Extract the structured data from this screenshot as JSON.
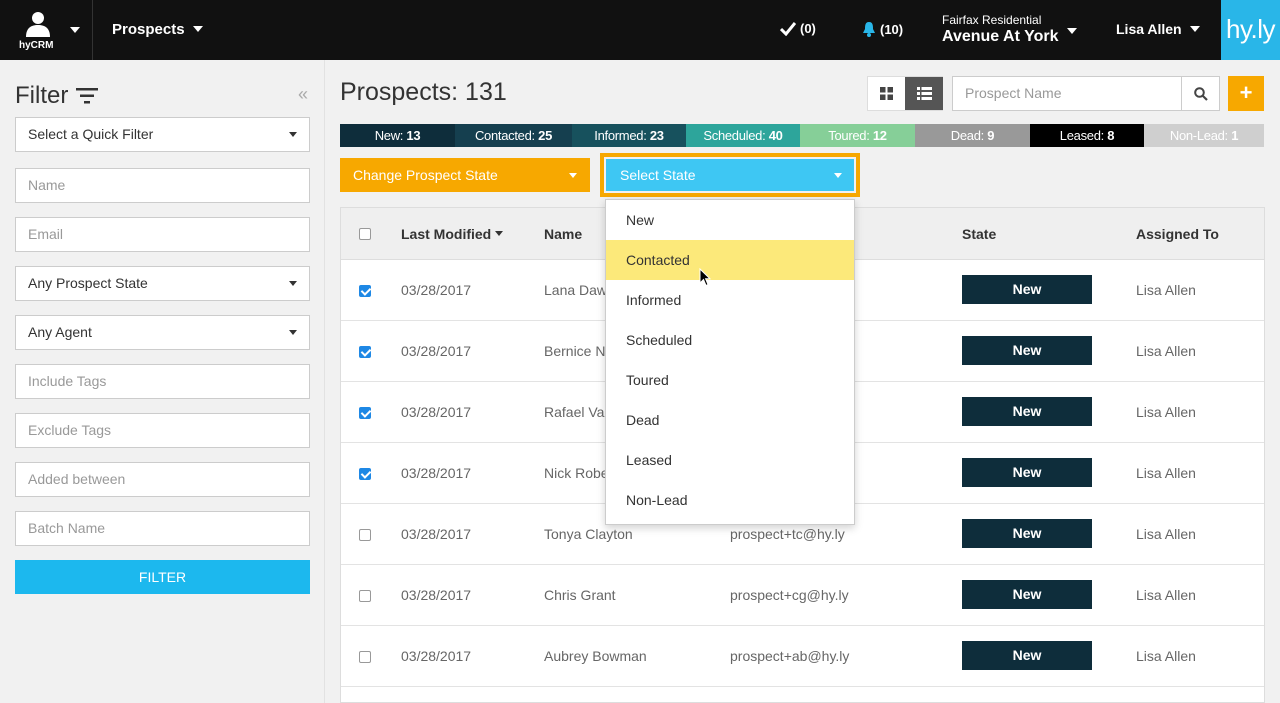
{
  "topbar": {
    "brand": "hyCRM",
    "module": "Prospects",
    "tasks": "(0)",
    "notifications": "(10)",
    "company": "Fairfax Residential",
    "property": "Avenue At York",
    "user": "Lisa Allen",
    "logo": "hy.ly"
  },
  "sidebar": {
    "title": "Filter",
    "quick_filter": "Select a Quick Filter",
    "name_placeholder": "Name",
    "email_placeholder": "Email",
    "prospect_state": "Any Prospect State",
    "agent": "Any Agent",
    "include_tags": "Include Tags",
    "exclude_tags": "Exclude Tags",
    "added_between": "Added between",
    "batch_name": "Batch Name",
    "filter_button": "FILTER"
  },
  "main": {
    "title": "Prospects: 131",
    "search_placeholder": "Prospect Name",
    "add_label": "+",
    "states": [
      {
        "label": "New:",
        "count": "13",
        "color": "#0e2d3b"
      },
      {
        "label": "Contacted:",
        "count": "25",
        "color": "#153f4f"
      },
      {
        "label": "Informed:",
        "count": "23",
        "color": "#17515d"
      },
      {
        "label": "Scheduled:",
        "count": "40",
        "color": "#2da59b"
      },
      {
        "label": "Toured:",
        "count": "12",
        "color": "#86cf98"
      },
      {
        "label": "Dead:",
        "count": "9",
        "color": "#999999"
      },
      {
        "label": "Leased:",
        "count": "8",
        "color": "#000000"
      },
      {
        "label": "Non-Lead:",
        "count": "1",
        "color": "#cfcfcf"
      }
    ],
    "change_state_button": "Change Prospect State",
    "select_state": "Select State"
  },
  "table": {
    "headers": {
      "last_modified": "Last Modified",
      "name": "Name",
      "state": "State",
      "assigned_to": "Assigned To"
    },
    "rows": [
      {
        "checked": true,
        "date": "03/28/2017",
        "name": "Lana Daw",
        "email": "",
        "state": "New",
        "agent": "Lisa Allen"
      },
      {
        "checked": true,
        "date": "03/28/2017",
        "name": "Bernice N",
        "email": "",
        "state": "New",
        "agent": "Lisa Allen"
      },
      {
        "checked": true,
        "date": "03/28/2017",
        "name": "Rafael Val",
        "email": "",
        "state": "New",
        "agent": "Lisa Allen"
      },
      {
        "checked": true,
        "date": "03/28/2017",
        "name": "Nick Robe",
        "email": "",
        "state": "New",
        "agent": "Lisa Allen"
      },
      {
        "checked": false,
        "date": "03/28/2017",
        "name": "Tonya Clayton",
        "email": "prospect+tc@hy.ly",
        "state": "New",
        "agent": "Lisa Allen"
      },
      {
        "checked": false,
        "date": "03/28/2017",
        "name": "Chris Grant",
        "email": "prospect+cg@hy.ly",
        "state": "New",
        "agent": "Lisa Allen"
      },
      {
        "checked": false,
        "date": "03/28/2017",
        "name": "Aubrey Bowman",
        "email": "prospect+ab@hy.ly",
        "state": "New",
        "agent": "Lisa Allen"
      }
    ]
  },
  "dropdown": {
    "items": [
      "New",
      "Contacted",
      "Informed",
      "Scheduled",
      "Toured",
      "Dead",
      "Leased",
      "Non-Lead"
    ],
    "highlighted": "Contacted"
  }
}
